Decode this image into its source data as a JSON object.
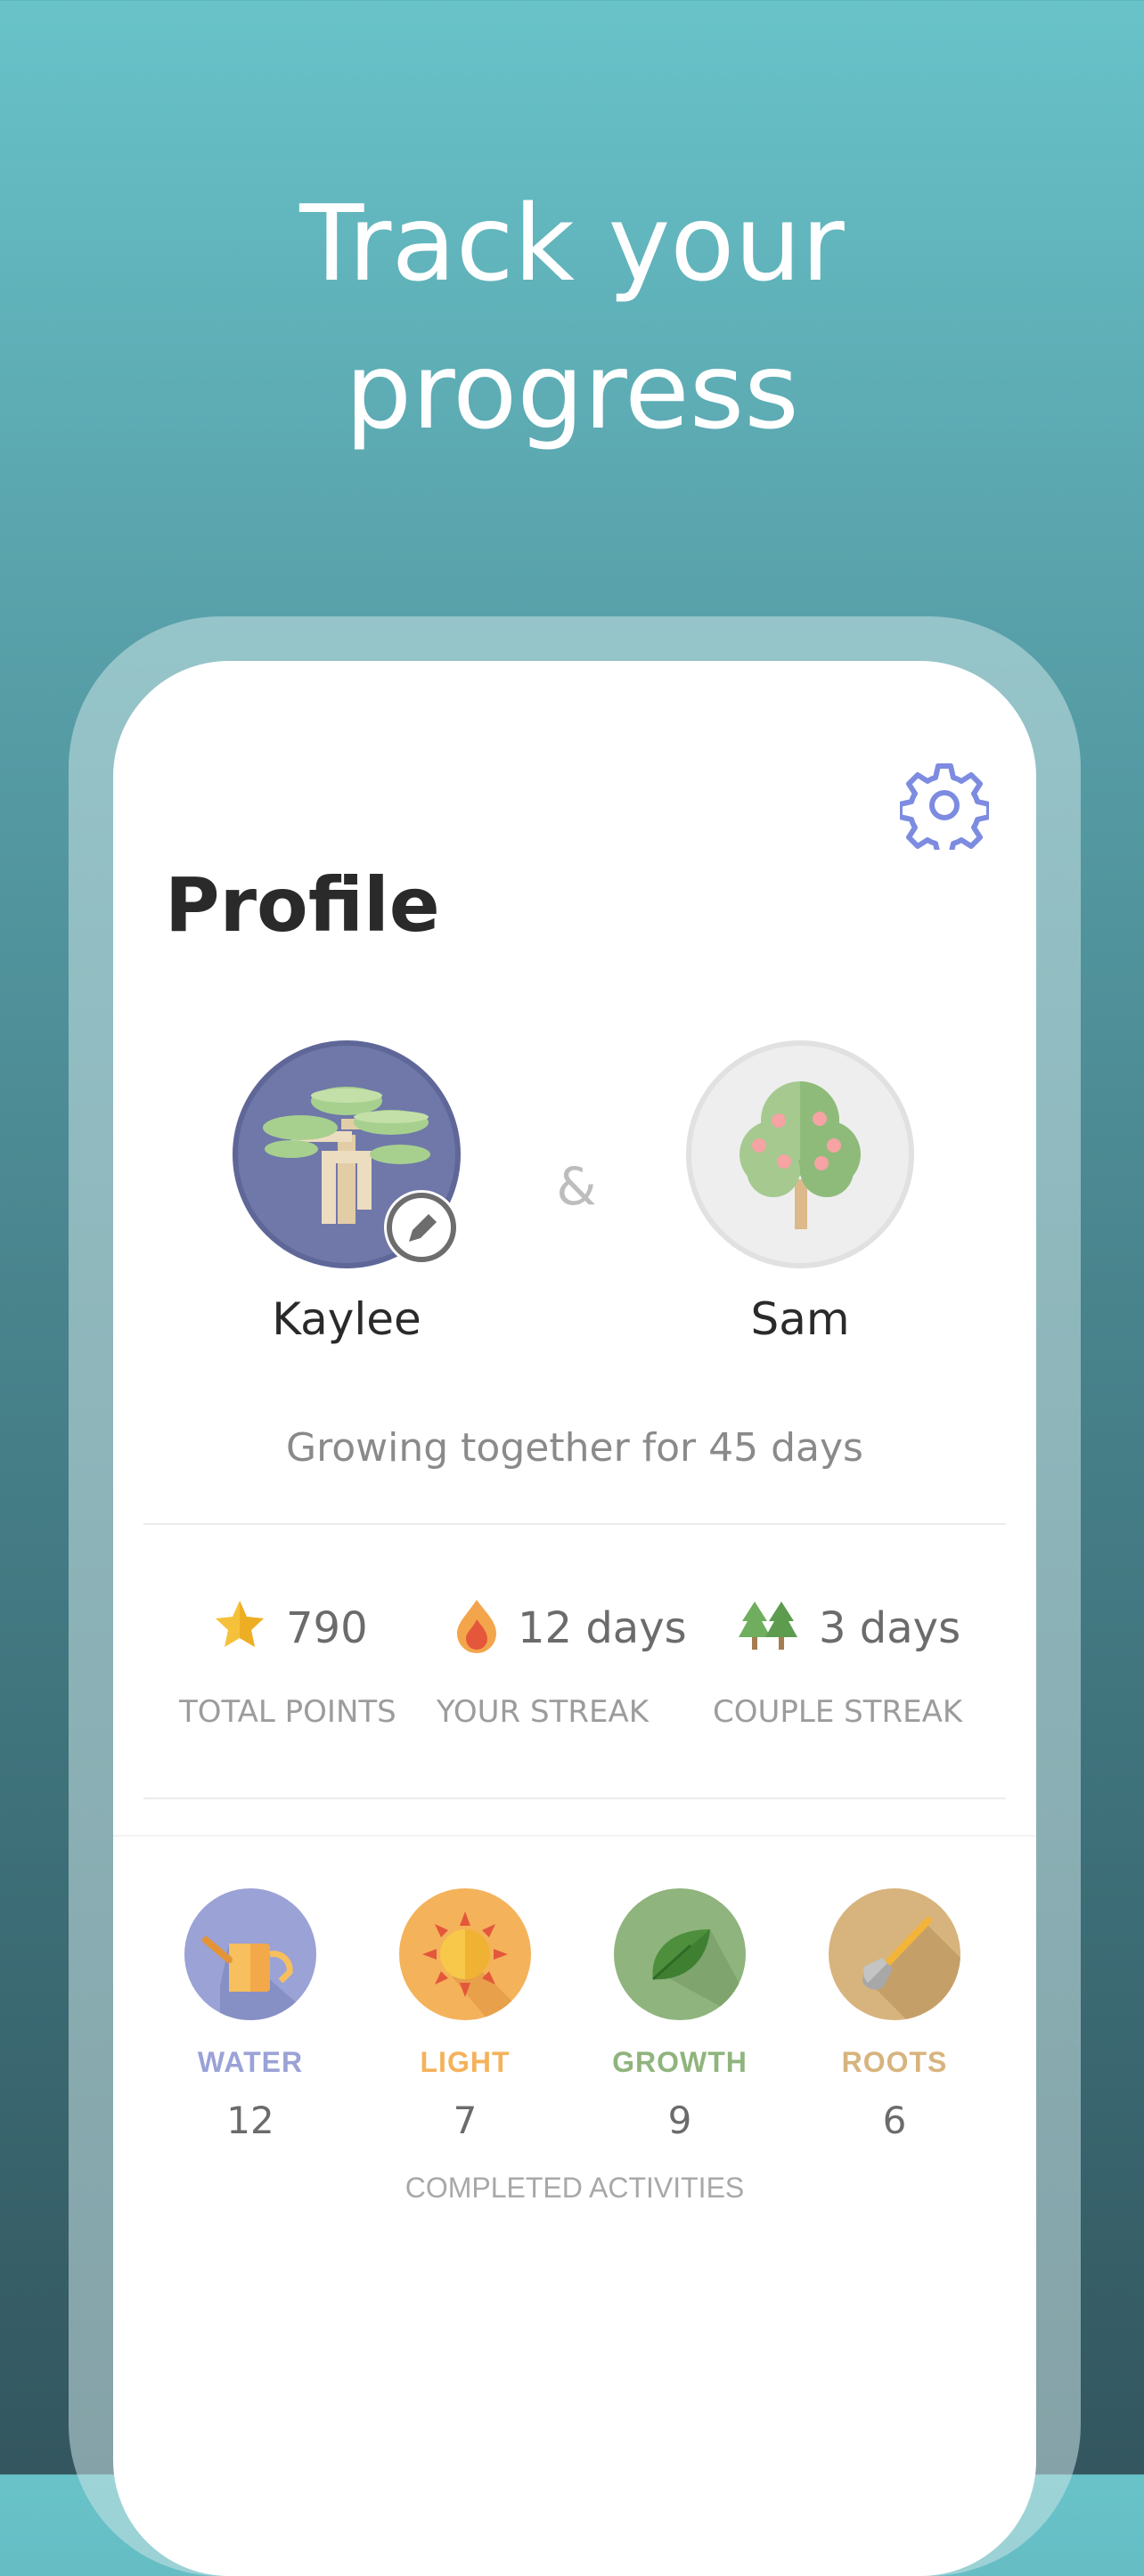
{
  "headline": {
    "line1": "Track your",
    "line2": "progress"
  },
  "profile": {
    "title": "Profile",
    "settings_icon": "gear-icon",
    "user": {
      "name": "Kaylee",
      "avatar": "tree-avatar",
      "edit_icon": "pencil-icon"
    },
    "separator": "&",
    "partner": {
      "name": "Sam",
      "avatar": "fruit-tree-avatar"
    },
    "together_text": "Growing together for 45 days"
  },
  "stats": [
    {
      "icon": "star-icon",
      "value": "790",
      "label": "TOTAL POINTS"
    },
    {
      "icon": "flame-icon",
      "value": "12 days",
      "label": "YOUR STREAK"
    },
    {
      "icon": "pine-trees-icon",
      "value": "3 days",
      "label": "COUPLE STREAK"
    }
  ],
  "activities": [
    {
      "icon": "watering-can-icon",
      "label": "WATER",
      "count": "12",
      "color": "#9aa2d6"
    },
    {
      "icon": "sun-icon",
      "label": "LIGHT",
      "count": "7",
      "color": "#f4b25a"
    },
    {
      "icon": "leaf-icon",
      "label": "GROWTH",
      "count": "9",
      "color": "#8fb47d"
    },
    {
      "icon": "shovel-icon",
      "label": "ROOTS",
      "count": "6",
      "color": "#d7b47e"
    }
  ],
  "completed_label": "COMPLETED ACTIVITIES"
}
